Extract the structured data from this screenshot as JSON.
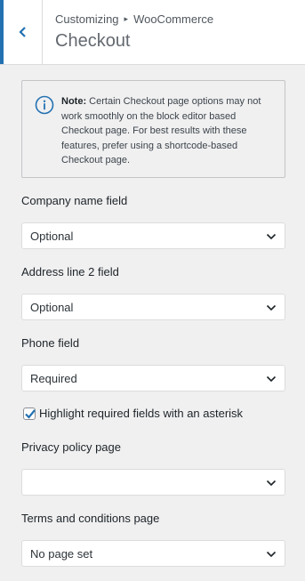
{
  "header": {
    "breadcrumb_parent": "Customizing",
    "breadcrumb_separator": "▸",
    "breadcrumb_section": "WooCommerce",
    "title": "Checkout"
  },
  "notice": {
    "label": "Note:",
    "text": " Certain Checkout page options may not work smoothly on the block editor based Checkout page. For best results with these features, prefer using a shortcode-based Checkout page."
  },
  "fields": {
    "company_name": {
      "label": "Company name field",
      "value": "Optional"
    },
    "address_line2": {
      "label": "Address line 2 field",
      "value": "Optional"
    },
    "phone": {
      "label": "Phone field",
      "value": "Required"
    },
    "highlight_required": {
      "label": "Highlight required fields with an asterisk",
      "checked": true
    },
    "privacy_policy": {
      "label": "Privacy policy page",
      "value": ""
    },
    "terms_conditions": {
      "label": "Terms and conditions page",
      "value": "No page set"
    }
  },
  "colors": {
    "accent": "#2271b1",
    "background": "#f0f0f1"
  }
}
